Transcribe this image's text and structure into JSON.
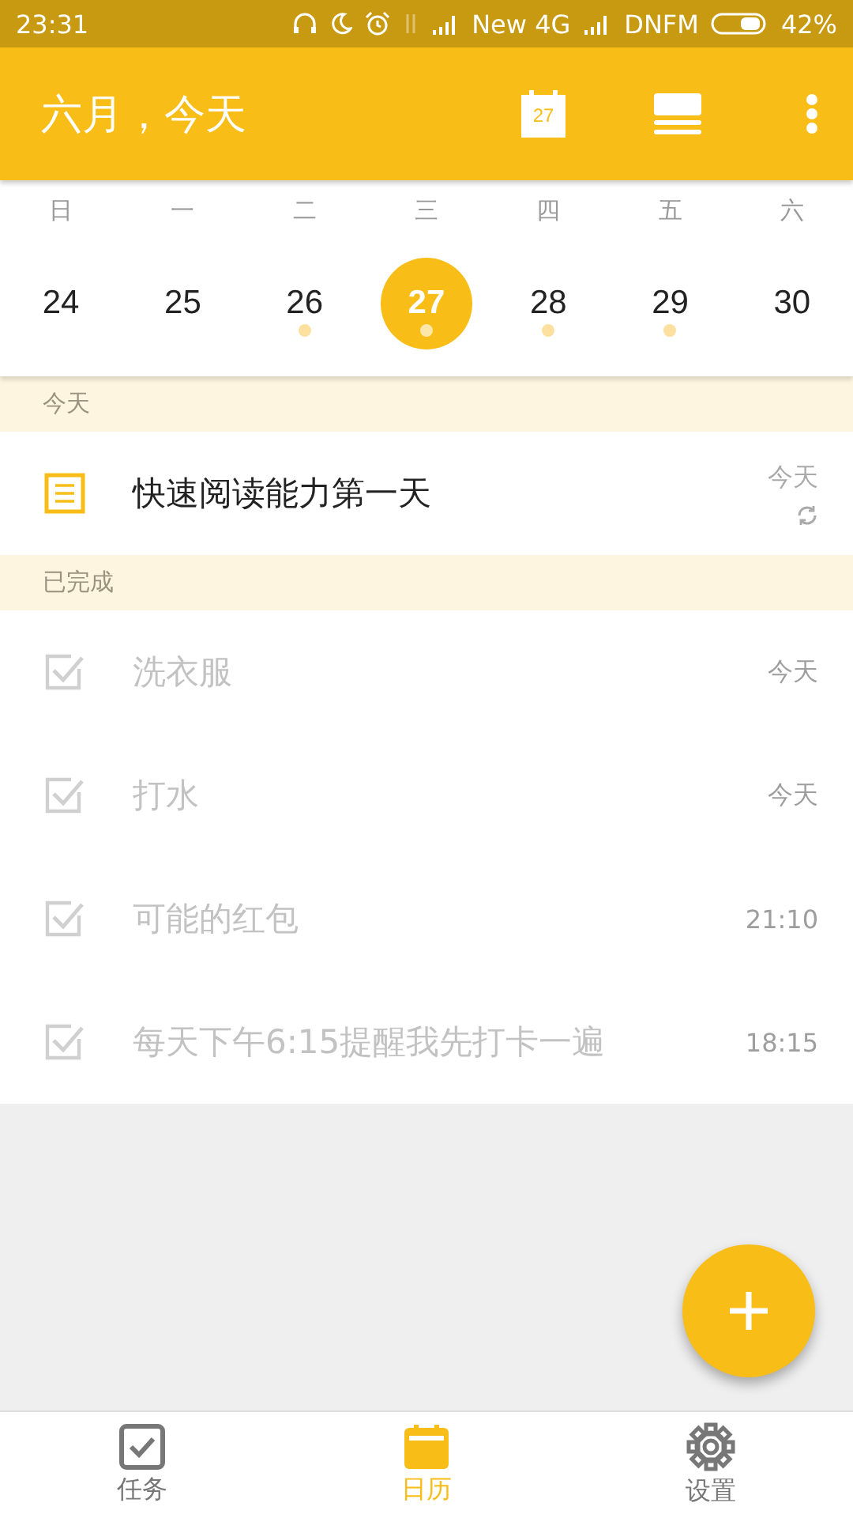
{
  "status_bar": {
    "time": "23:31",
    "network": "New 4G",
    "carrier": "DNFM",
    "battery": "42%"
  },
  "app_bar": {
    "title": "六月，今天",
    "calendar_day": "27"
  },
  "week": [
    {
      "weekday": "日",
      "date": "24",
      "selected": false,
      "has_tasks": false
    },
    {
      "weekday": "一",
      "date": "25",
      "selected": false,
      "has_tasks": false
    },
    {
      "weekday": "二",
      "date": "26",
      "selected": false,
      "has_tasks": true
    },
    {
      "weekday": "三",
      "date": "27",
      "selected": true,
      "has_tasks": true
    },
    {
      "weekday": "四",
      "date": "28",
      "selected": false,
      "has_tasks": true
    },
    {
      "weekday": "五",
      "date": "29",
      "selected": false,
      "has_tasks": true
    },
    {
      "weekday": "六",
      "date": "30",
      "selected": false,
      "has_tasks": false
    }
  ],
  "sections": [
    {
      "title": "今天",
      "tasks": [
        {
          "kind": "note",
          "title": "快速阅读能力第一天",
          "time": "今天",
          "repeating": true
        }
      ]
    },
    {
      "title": "已完成",
      "tasks": [
        {
          "kind": "checkbox",
          "checked": true,
          "title": "洗衣服",
          "time": "今天",
          "repeating": false
        },
        {
          "kind": "checkbox",
          "checked": true,
          "title": "打水",
          "time": "今天",
          "repeating": false
        },
        {
          "kind": "checkbox",
          "checked": true,
          "title": "可能的红包",
          "time": "21:10",
          "repeating": false
        },
        {
          "kind": "checkbox",
          "checked": true,
          "title": "每天下午6:15提醒我先打卡一遍",
          "time": "18:15",
          "repeating": false
        }
      ]
    }
  ],
  "bottom_nav": [
    {
      "kind": "tasks",
      "label": "任务",
      "selected": false
    },
    {
      "kind": "calendar",
      "label": "日历",
      "selected": true
    },
    {
      "kind": "settings",
      "label": "设置",
      "selected": false
    }
  ]
}
